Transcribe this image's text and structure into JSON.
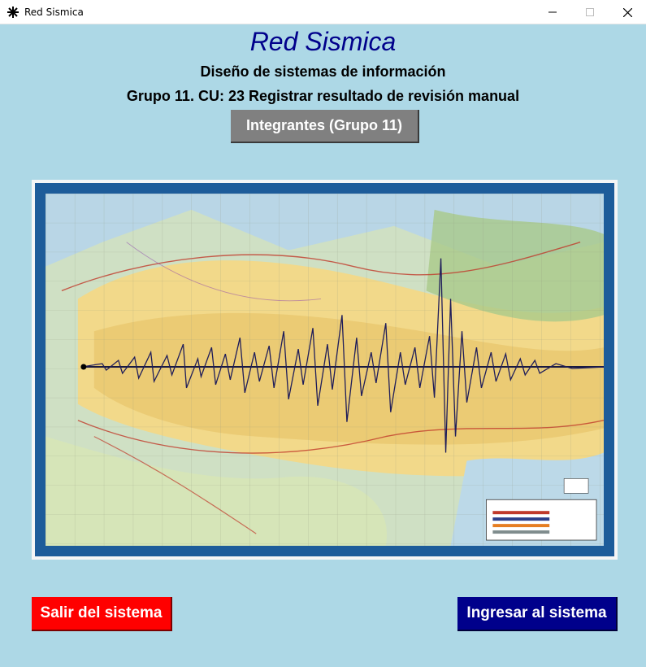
{
  "window": {
    "title": "Red Sismica"
  },
  "header": {
    "title": "Red Sismica",
    "subtitle": "Diseño de sistemas de información",
    "subtitle2": "Grupo 11. CU: 23 Registrar resultado de revisión manual"
  },
  "buttons": {
    "members": "Integrantes (Grupo 11)",
    "exit": "Salir del sistema",
    "enter": "Ingresar al sistema"
  },
  "colors": {
    "background": "#add8e6",
    "title": "#00008b",
    "exit_button": "#ff0000",
    "enter_button": "#00008b",
    "members_button": "#808080"
  },
  "image": {
    "icon": "seismic-map-image"
  }
}
